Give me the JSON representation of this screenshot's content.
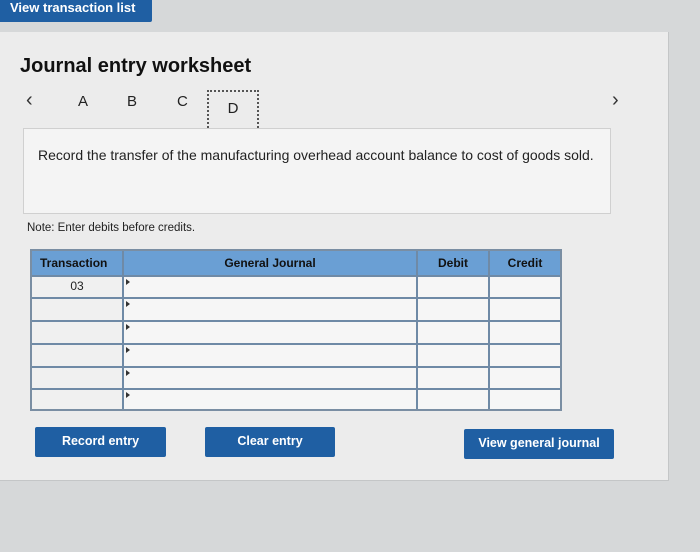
{
  "top_button": "View transaction list",
  "worksheet_title": "Journal entry worksheet",
  "nav": {
    "prev_icon": "chevron-left-icon",
    "next_icon": "chevron-right-icon",
    "tabs": [
      "A",
      "B",
      "C",
      "D"
    ],
    "active_tab": "D"
  },
  "instruction": "Record the transfer of the manufacturing overhead account balance to cost of goods sold.",
  "note": "Note: Enter debits before credits.",
  "table": {
    "headers": [
      "Transaction",
      "General Journal",
      "Debit",
      "Credit"
    ],
    "transaction_values": [
      "03",
      "",
      "",
      "",
      "",
      ""
    ]
  },
  "buttons": {
    "record": "Record entry",
    "clear": "Clear entry",
    "view_journal": "View general journal"
  },
  "colors": {
    "accent": "#1f5fa3",
    "header_blue": "#6a9fd4"
  }
}
